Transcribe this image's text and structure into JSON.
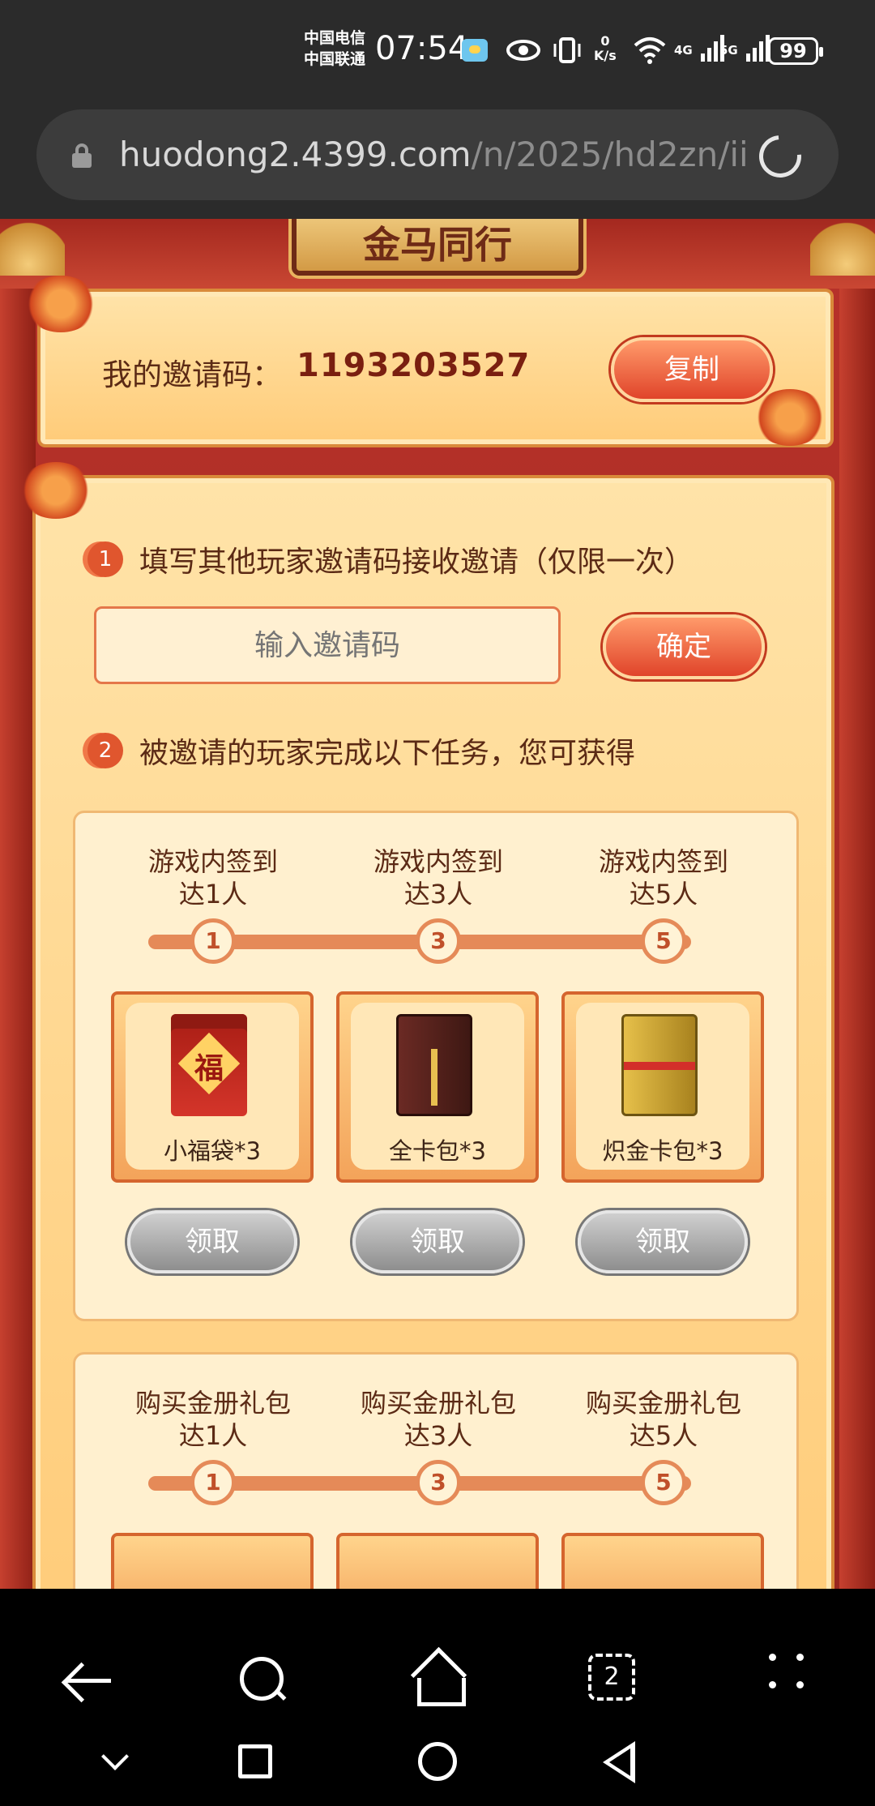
{
  "status_bar": {
    "carrier_1": "中国电信",
    "carrier_2": "中国联通",
    "time": "07:54",
    "net_speed_value": "0",
    "net_speed_unit": "K/s",
    "net_1": "4G",
    "net_2": "5G",
    "battery": "99"
  },
  "browser": {
    "url_host": "huodong2.4399.com",
    "url_path": "/n/2025/hd2zn/ii"
  },
  "page": {
    "title_text": "金马同行",
    "invite": {
      "label": "我的邀请码：",
      "code": "1193203527",
      "copy_label": "复制"
    },
    "step1": {
      "number": "1",
      "text": "填写其他玩家邀请码接收邀请（仅限一次）",
      "input_placeholder": "输入邀请码",
      "confirm_label": "确定"
    },
    "step2": {
      "number": "2",
      "text": "被邀请的玩家完成以下任务，您可获得"
    },
    "task_group_1": {
      "conditions": [
        "游戏内签到\n达1人",
        "游戏内签到\n达3人",
        "游戏内签到\n达5人"
      ],
      "nodes": [
        "1",
        "3",
        "5"
      ],
      "rewards": [
        "小福袋*3",
        "全卡包*3",
        "炽金卡包*3"
      ],
      "claim_label": "领取",
      "bag_char": "福"
    },
    "task_group_2": {
      "conditions": [
        "购买金册礼包\n达1人",
        "购买金册礼包\n达3人",
        "购买金册礼包\n达5人"
      ],
      "nodes": [
        "1",
        "3",
        "5"
      ]
    }
  },
  "nav": {
    "tabs_count": "2"
  },
  "colors": {
    "accent_red": "#e0442a",
    "panel_bg": "#ffe3a8",
    "text_brown": "#5b2a15"
  }
}
